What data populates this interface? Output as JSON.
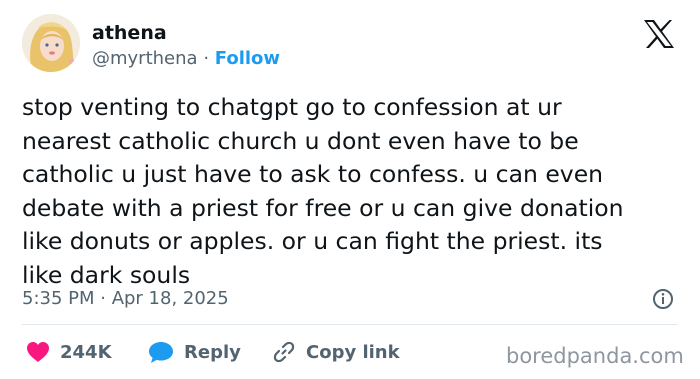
{
  "author": {
    "name": "athena",
    "handle": "@myrthena",
    "separator": "·",
    "follow_label": "Follow"
  },
  "tweet": {
    "lines": [
      "stop venting to chatgpt go to confession at ur",
      "nearest catholic church u dont even have to be",
      "catholic u just have to ask to confess. u can even",
      "debate with a priest for free or u can give donation",
      "like donuts or apples. or u can fight the priest. its",
      "like dark souls"
    ],
    "timestamp": "5:35 PM · Apr 18, 2025"
  },
  "actions": {
    "likes": "244K",
    "reply_label": "Reply",
    "copy_link_label": "Copy link"
  },
  "watermark": "boredpanda.com",
  "icons": {
    "brand": "x-logo-icon",
    "info": "info-icon",
    "like": "heart-icon",
    "reply": "reply-bubble-icon",
    "copy": "link-icon"
  },
  "colors": {
    "text": "#0f1419",
    "secondary": "#536471",
    "accent": "#1d9bf0",
    "heart": "#f91880",
    "reply": "#1d9bf0"
  }
}
